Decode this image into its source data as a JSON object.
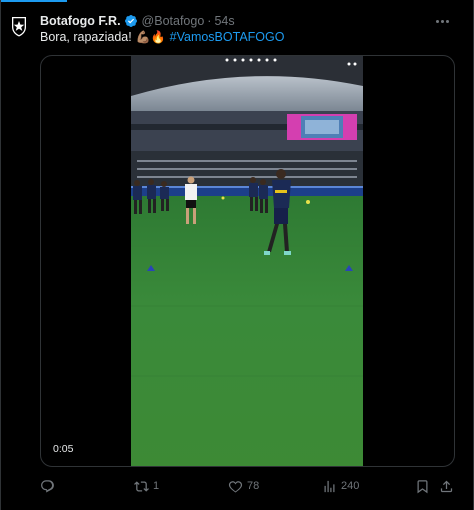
{
  "tweet": {
    "author_name": "Botafogo F.R.",
    "handle": "@Botafogo",
    "separator": "·",
    "time": "54s",
    "text_main": "Bora, rapaziada!",
    "emojis": "💪🏽🔥",
    "hashtag": "#VamosBOTAFOGO"
  },
  "media": {
    "duration": "0:05"
  },
  "actions": {
    "replies": "",
    "retweets": "1",
    "likes": "78",
    "views": "240"
  },
  "colors": {
    "accent": "#1d9bf0",
    "muted": "#71767b",
    "background": "#000000",
    "text": "#e7e9ea"
  }
}
